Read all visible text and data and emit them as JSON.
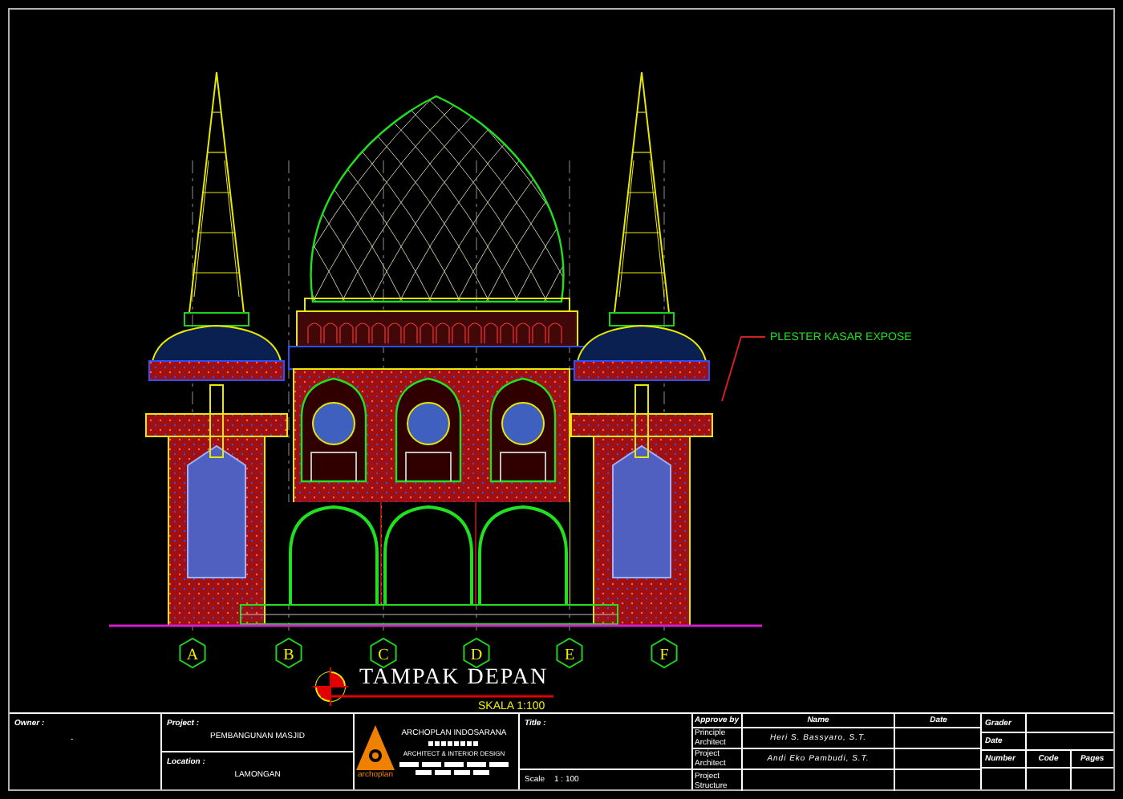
{
  "drawing": {
    "callout": "PLESTER KASAR EXPOSE",
    "grid_labels": [
      "A",
      "B",
      "C",
      "D",
      "E",
      "F"
    ],
    "title": "TAMPAK DEPAN",
    "scale": "SKALA 1:100"
  },
  "title_block": {
    "owner": {
      "label": "Owner :",
      "value": "-"
    },
    "project": {
      "label": "Project :",
      "value": "PEMBANGUNAN MASJID"
    },
    "location": {
      "label": "Location :",
      "value": "LAMONGAN"
    },
    "firm": {
      "logo_text": "archoplan",
      "name": "ARCHOPLAN INDOSARANA",
      "tagline": "ARCHITECT & INTERIOR DESIGN"
    },
    "title": {
      "label": "Title :"
    },
    "scale": {
      "label": "Scale",
      "value": "1 : 100"
    },
    "approvals": {
      "headers": [
        "Approve by",
        "Name",
        "Date"
      ],
      "rows": [
        {
          "role": "Principle Architect",
          "name": "Heri S. Bassyaro, S.T."
        },
        {
          "role": "Project Architect",
          "name": "Andi Eko Pambudi, S.T."
        },
        {
          "role": "Project Structure"
        }
      ]
    },
    "grader": {
      "label": "Grader"
    },
    "date": {
      "label": "Date"
    },
    "sheet": [
      "Number",
      "Code",
      "Pages"
    ]
  }
}
